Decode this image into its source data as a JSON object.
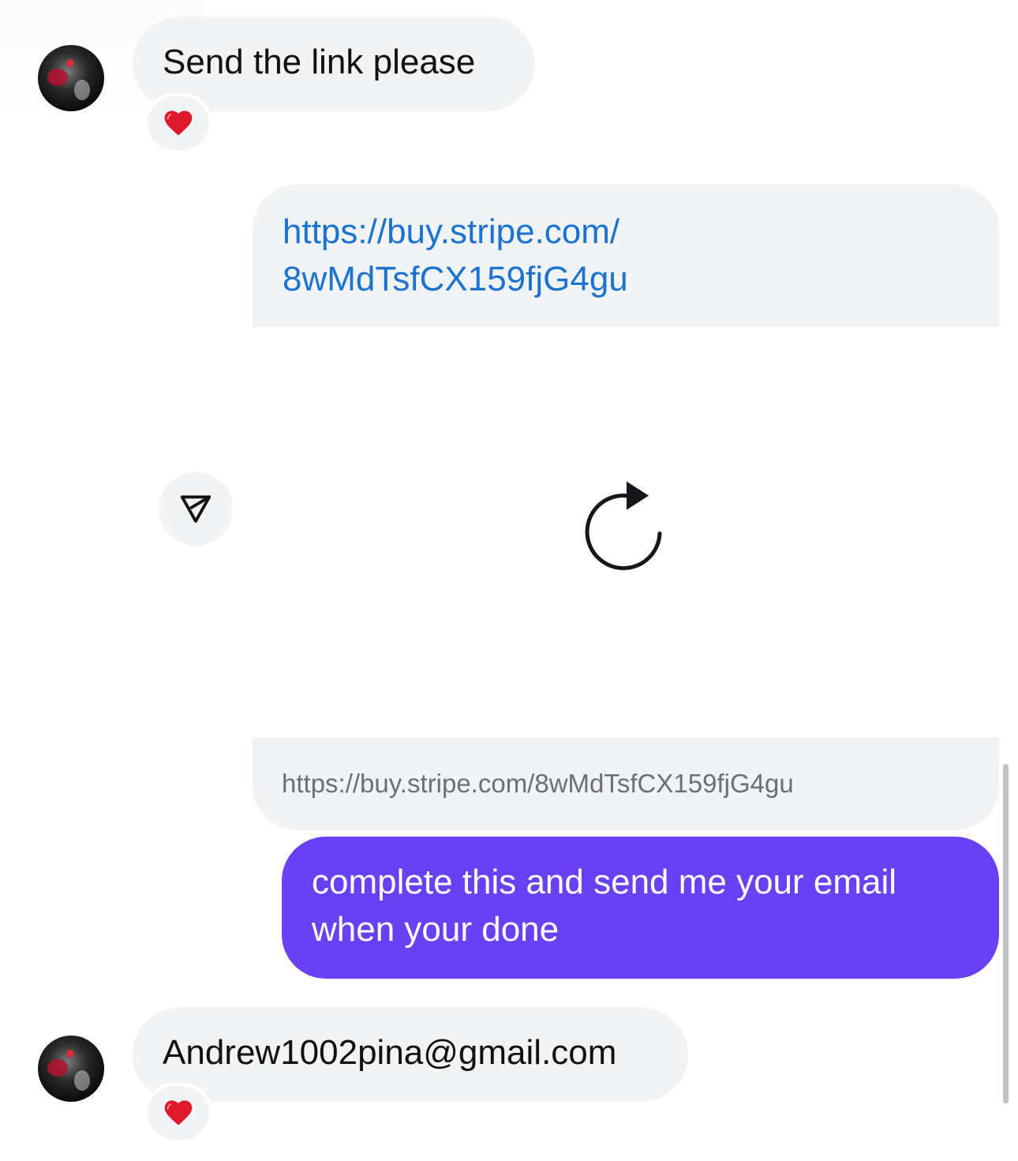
{
  "messages": [
    {
      "direction": "incoming",
      "text": "Send the link please",
      "reaction": "heart"
    },
    {
      "direction": "outgoing",
      "link_lines": [
        "https://buy.stripe.com/",
        "8wMdTsfCX159fjG4gu"
      ],
      "preview_url": "https://buy.stripe.com/8wMdTsfCX159fjG4gu"
    },
    {
      "direction": "outgoing",
      "text_lines": [
        "complete this and send me your email",
        "when your done"
      ]
    },
    {
      "direction": "incoming",
      "text": "Andrew1002pina@gmail.com",
      "reaction": "heart"
    }
  ],
  "icons": {
    "share": "send-icon",
    "reload": "reload-icon",
    "reaction": "heart-icon"
  },
  "colors": {
    "incoming_bubble": "#f2f3f5",
    "outgoing_bubble": "#6a40f5",
    "link": "#1a73d0",
    "heart": "#e0182b"
  }
}
